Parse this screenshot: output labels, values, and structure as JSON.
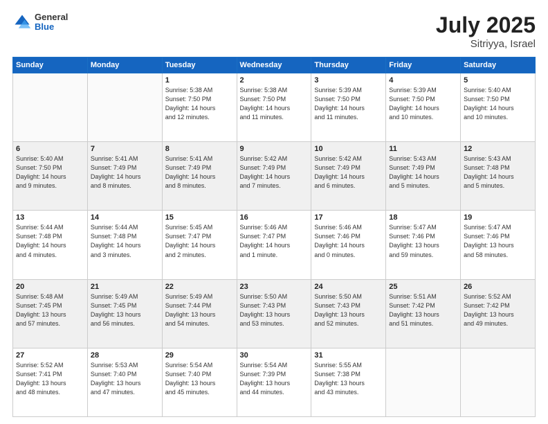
{
  "header": {
    "logo_general": "General",
    "logo_blue": "Blue",
    "title": "July 2025",
    "location": "Sitriyya, Israel"
  },
  "days_of_week": [
    "Sunday",
    "Monday",
    "Tuesday",
    "Wednesday",
    "Thursday",
    "Friday",
    "Saturday"
  ],
  "weeks": [
    [
      {
        "day": "",
        "info": ""
      },
      {
        "day": "",
        "info": ""
      },
      {
        "day": "1",
        "info": "Sunrise: 5:38 AM\nSunset: 7:50 PM\nDaylight: 14 hours\nand 12 minutes."
      },
      {
        "day": "2",
        "info": "Sunrise: 5:38 AM\nSunset: 7:50 PM\nDaylight: 14 hours\nand 11 minutes."
      },
      {
        "day": "3",
        "info": "Sunrise: 5:39 AM\nSunset: 7:50 PM\nDaylight: 14 hours\nand 11 minutes."
      },
      {
        "day": "4",
        "info": "Sunrise: 5:39 AM\nSunset: 7:50 PM\nDaylight: 14 hours\nand 10 minutes."
      },
      {
        "day": "5",
        "info": "Sunrise: 5:40 AM\nSunset: 7:50 PM\nDaylight: 14 hours\nand 10 minutes."
      }
    ],
    [
      {
        "day": "6",
        "info": "Sunrise: 5:40 AM\nSunset: 7:50 PM\nDaylight: 14 hours\nand 9 minutes."
      },
      {
        "day": "7",
        "info": "Sunrise: 5:41 AM\nSunset: 7:49 PM\nDaylight: 14 hours\nand 8 minutes."
      },
      {
        "day": "8",
        "info": "Sunrise: 5:41 AM\nSunset: 7:49 PM\nDaylight: 14 hours\nand 8 minutes."
      },
      {
        "day": "9",
        "info": "Sunrise: 5:42 AM\nSunset: 7:49 PM\nDaylight: 14 hours\nand 7 minutes."
      },
      {
        "day": "10",
        "info": "Sunrise: 5:42 AM\nSunset: 7:49 PM\nDaylight: 14 hours\nand 6 minutes."
      },
      {
        "day": "11",
        "info": "Sunrise: 5:43 AM\nSunset: 7:49 PM\nDaylight: 14 hours\nand 5 minutes."
      },
      {
        "day": "12",
        "info": "Sunrise: 5:43 AM\nSunset: 7:48 PM\nDaylight: 14 hours\nand 5 minutes."
      }
    ],
    [
      {
        "day": "13",
        "info": "Sunrise: 5:44 AM\nSunset: 7:48 PM\nDaylight: 14 hours\nand 4 minutes."
      },
      {
        "day": "14",
        "info": "Sunrise: 5:44 AM\nSunset: 7:48 PM\nDaylight: 14 hours\nand 3 minutes."
      },
      {
        "day": "15",
        "info": "Sunrise: 5:45 AM\nSunset: 7:47 PM\nDaylight: 14 hours\nand 2 minutes."
      },
      {
        "day": "16",
        "info": "Sunrise: 5:46 AM\nSunset: 7:47 PM\nDaylight: 14 hours\nand 1 minute."
      },
      {
        "day": "17",
        "info": "Sunrise: 5:46 AM\nSunset: 7:46 PM\nDaylight: 14 hours\nand 0 minutes."
      },
      {
        "day": "18",
        "info": "Sunrise: 5:47 AM\nSunset: 7:46 PM\nDaylight: 13 hours\nand 59 minutes."
      },
      {
        "day": "19",
        "info": "Sunrise: 5:47 AM\nSunset: 7:46 PM\nDaylight: 13 hours\nand 58 minutes."
      }
    ],
    [
      {
        "day": "20",
        "info": "Sunrise: 5:48 AM\nSunset: 7:45 PM\nDaylight: 13 hours\nand 57 minutes."
      },
      {
        "day": "21",
        "info": "Sunrise: 5:49 AM\nSunset: 7:45 PM\nDaylight: 13 hours\nand 56 minutes."
      },
      {
        "day": "22",
        "info": "Sunrise: 5:49 AM\nSunset: 7:44 PM\nDaylight: 13 hours\nand 54 minutes."
      },
      {
        "day": "23",
        "info": "Sunrise: 5:50 AM\nSunset: 7:43 PM\nDaylight: 13 hours\nand 53 minutes."
      },
      {
        "day": "24",
        "info": "Sunrise: 5:50 AM\nSunset: 7:43 PM\nDaylight: 13 hours\nand 52 minutes."
      },
      {
        "day": "25",
        "info": "Sunrise: 5:51 AM\nSunset: 7:42 PM\nDaylight: 13 hours\nand 51 minutes."
      },
      {
        "day": "26",
        "info": "Sunrise: 5:52 AM\nSunset: 7:42 PM\nDaylight: 13 hours\nand 49 minutes."
      }
    ],
    [
      {
        "day": "27",
        "info": "Sunrise: 5:52 AM\nSunset: 7:41 PM\nDaylight: 13 hours\nand 48 minutes."
      },
      {
        "day": "28",
        "info": "Sunrise: 5:53 AM\nSunset: 7:40 PM\nDaylight: 13 hours\nand 47 minutes."
      },
      {
        "day": "29",
        "info": "Sunrise: 5:54 AM\nSunset: 7:40 PM\nDaylight: 13 hours\nand 45 minutes."
      },
      {
        "day": "30",
        "info": "Sunrise: 5:54 AM\nSunset: 7:39 PM\nDaylight: 13 hours\nand 44 minutes."
      },
      {
        "day": "31",
        "info": "Sunrise: 5:55 AM\nSunset: 7:38 PM\nDaylight: 13 hours\nand 43 minutes."
      },
      {
        "day": "",
        "info": ""
      },
      {
        "day": "",
        "info": ""
      }
    ]
  ]
}
